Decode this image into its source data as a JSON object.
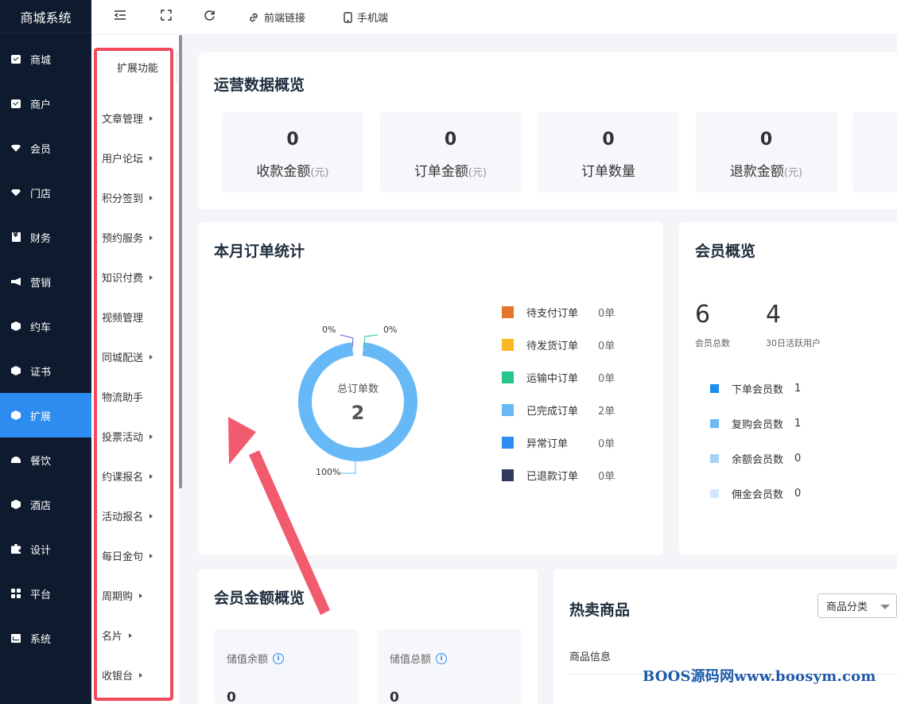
{
  "app": {
    "title": "商城系统"
  },
  "sidebar": {
    "items": [
      {
        "label": "商城",
        "icon": "box-check-icon"
      },
      {
        "label": "商户",
        "icon": "box-check-icon"
      },
      {
        "label": "会员",
        "icon": "diamond-icon"
      },
      {
        "label": "门店",
        "icon": "diamond-icon"
      },
      {
        "label": "财务",
        "icon": "wallet-icon"
      },
      {
        "label": "营销",
        "icon": "megaphone-icon"
      },
      {
        "label": "约车",
        "icon": "cube-icon"
      },
      {
        "label": "证书",
        "icon": "cube-icon"
      },
      {
        "label": "扩展",
        "icon": "cube-icon",
        "active": true
      },
      {
        "label": "餐饮",
        "icon": "bell-icon"
      },
      {
        "label": "酒店",
        "icon": "cube-icon"
      },
      {
        "label": "设计",
        "icon": "puzzle-icon"
      },
      {
        "label": "平台",
        "icon": "grid-icon"
      },
      {
        "label": "系统",
        "icon": "chart-icon"
      }
    ]
  },
  "topbar": {
    "frontend_link": "前端链接",
    "mobile": "手机端"
  },
  "submenu": {
    "title": "扩展功能",
    "items": [
      {
        "label": "文章管理",
        "expandable": true
      },
      {
        "label": "用户论坛",
        "expandable": true
      },
      {
        "label": "积分签到",
        "expandable": true
      },
      {
        "label": "预约服务",
        "expandable": true
      },
      {
        "label": "知识付费",
        "expandable": true
      },
      {
        "label": "视频管理",
        "expandable": false
      },
      {
        "label": "同城配送",
        "expandable": true
      },
      {
        "label": "物流助手",
        "expandable": false
      },
      {
        "label": "投票活动",
        "expandable": true
      },
      {
        "label": "约课报名",
        "expandable": true
      },
      {
        "label": "活动报名",
        "expandable": true
      },
      {
        "label": "每日金句",
        "expandable": true
      },
      {
        "label": "周期购",
        "expandable": true
      },
      {
        "label": "名片",
        "expandable": true
      },
      {
        "label": "收银台",
        "expandable": true
      }
    ]
  },
  "overview": {
    "title": "运营数据概览",
    "stats": [
      {
        "value": "0",
        "label": "收款金额",
        "unit": "(元)"
      },
      {
        "value": "0",
        "label": "订单金额",
        "unit": "(元)"
      },
      {
        "value": "0",
        "label": "订单数量",
        "unit": ""
      },
      {
        "value": "0",
        "label": "退款金额",
        "unit": "(元)"
      }
    ]
  },
  "orders": {
    "title": "本月订单统计",
    "center_label": "总订单数",
    "center_value": "2",
    "pct_labels": [
      "0%",
      "0%",
      "100%"
    ],
    "legend": [
      {
        "label": "待支付订单",
        "count": "0单",
        "color": "#e8732f"
      },
      {
        "label": "待发货订单",
        "count": "0单",
        "color": "#fbb624"
      },
      {
        "label": "运输中订单",
        "count": "0单",
        "color": "#26c68a"
      },
      {
        "label": "已完成订单",
        "count": "2单",
        "color": "#66b8f7"
      },
      {
        "label": "异常订单",
        "count": "0单",
        "color": "#2f8cf0"
      },
      {
        "label": "已退款订单",
        "count": "0单",
        "color": "#2f3a5c"
      }
    ]
  },
  "chart_data": {
    "type": "pie",
    "categories": [
      "待支付订单",
      "待发货订单",
      "运输中订单",
      "已完成订单",
      "异常订单",
      "已退款订单"
    ],
    "values": [
      0,
      0,
      0,
      2,
      0,
      0
    ],
    "title": "本月订单统计"
  },
  "members": {
    "title": "会员概览",
    "total": "6",
    "total_label": "会员总数",
    "active": "4",
    "active_label": "30日活跃用户",
    "rows": [
      {
        "label": "下单会员数",
        "value": "1",
        "color": "#1e8ff0"
      },
      {
        "label": "复购会员数",
        "value": "1",
        "color": "#6bb8f2"
      },
      {
        "label": "余额会员数",
        "value": "0",
        "color": "#a5d2f6"
      },
      {
        "label": "佣金会员数",
        "value": "0",
        "color": "#d3e9fb"
      }
    ]
  },
  "amounts": {
    "title": "会员金额概览",
    "boxes": [
      {
        "label": "储值余额",
        "value": "0"
      },
      {
        "label": "储值总额",
        "value": "0"
      }
    ]
  },
  "hot": {
    "title": "热卖商品",
    "select": "商品分类",
    "col": "商品信息"
  },
  "watermark": "BOOS源码网www.boosym.com"
}
